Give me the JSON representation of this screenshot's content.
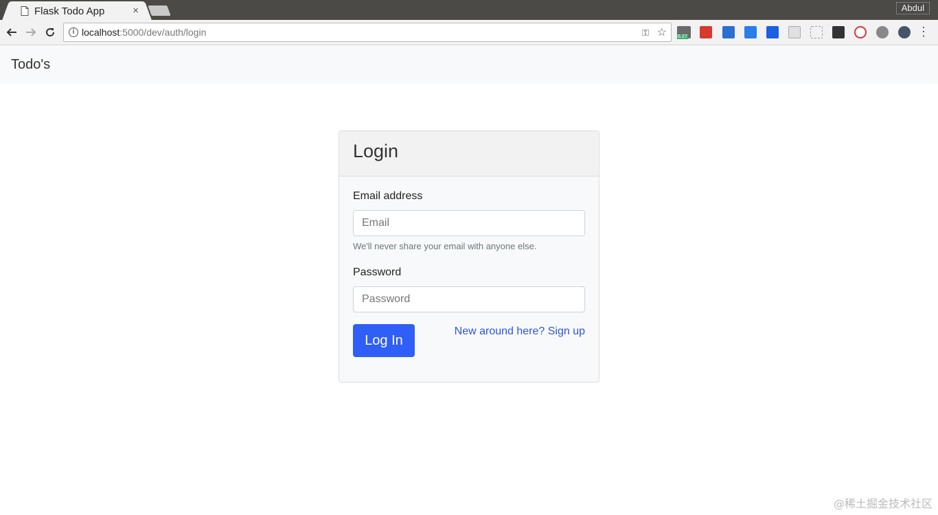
{
  "browser": {
    "tab_title": "Flask Todo App",
    "tab_close": "×",
    "profile_name": "Abdul",
    "url_host": "localhost",
    "url_rest": ":5000/dev/auth/login",
    "extension_badge": "6.27"
  },
  "page": {
    "brand": "Todo's",
    "card": {
      "title": "Login",
      "email_label": "Email address",
      "email_placeholder": "Email",
      "email_help": "We'll never share your email with anyone else.",
      "password_label": "Password",
      "password_placeholder": "Password",
      "login_button": "Log In",
      "signup_link": "New around here? Sign up"
    }
  },
  "watermark": "@稀土掘金技术社区",
  "colors": {
    "primary": "#2f5ff6",
    "link": "#2f55d4",
    "navbar_bg": "#f8f9fa"
  }
}
